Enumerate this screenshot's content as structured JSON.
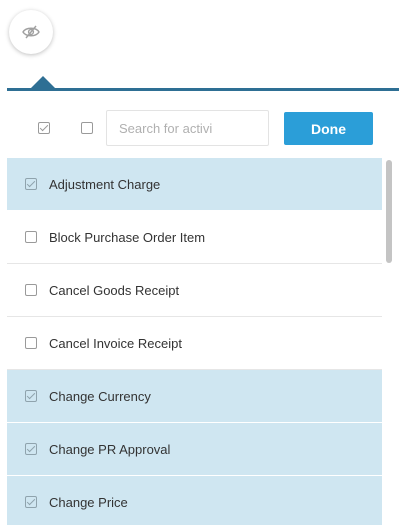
{
  "toolbar": {
    "search_placeholder": "Search for activi",
    "done_label": "Done"
  },
  "activities": [
    {
      "label": "Adjustment Charge",
      "checked": true
    },
    {
      "label": "Block Purchase Order Item",
      "checked": false
    },
    {
      "label": "Cancel Goods Receipt",
      "checked": false
    },
    {
      "label": "Cancel Invoice Receipt",
      "checked": false
    },
    {
      "label": "Change Currency",
      "checked": true
    },
    {
      "label": "Change PR Approval",
      "checked": true
    },
    {
      "label": "Change Price",
      "checked": true
    }
  ],
  "colors": {
    "accent": "#2e6f94",
    "done_button": "#2b9ed8",
    "selected_row": "#cfe6f1"
  },
  "icons": {
    "toggle": "eye-slash-icon"
  }
}
